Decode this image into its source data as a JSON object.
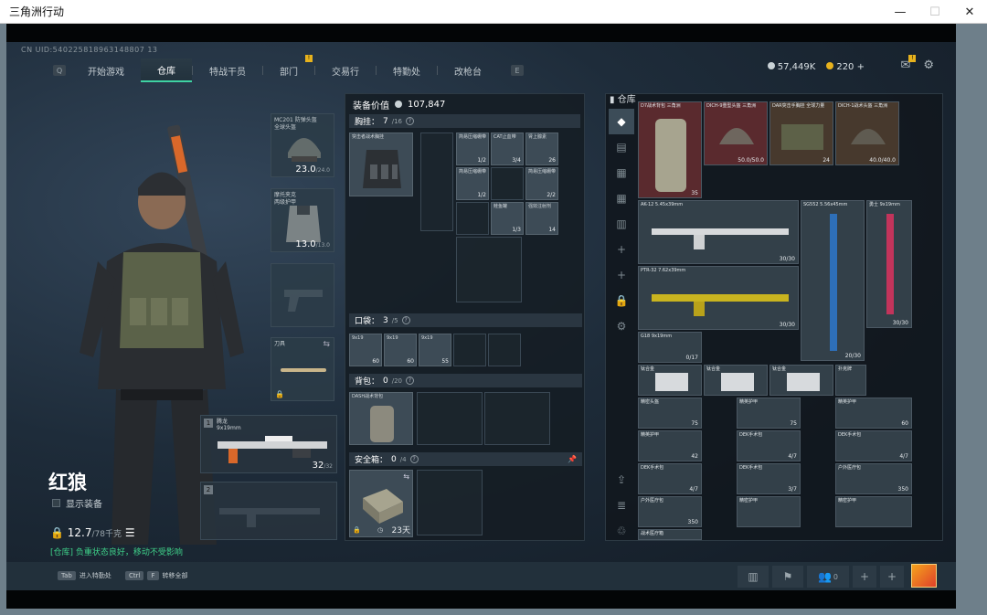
{
  "window": {
    "title": "三角洲行动",
    "minimize": "—",
    "maximize": "☐",
    "close": "✕"
  },
  "uid": "CN UID:540225818963148807 13",
  "nav": {
    "left_key": "Q",
    "right_key": "E",
    "tabs": [
      {
        "label": "开始游戏",
        "badge": ""
      },
      {
        "label": "仓库",
        "badge": ""
      },
      {
        "label": "特战干员",
        "badge": ""
      },
      {
        "label": "部门",
        "badge": "!"
      },
      {
        "label": "交易行",
        "badge": ""
      },
      {
        "label": "特勤处",
        "badge": ""
      },
      {
        "label": "改枪台",
        "badge": ""
      }
    ]
  },
  "currency": {
    "coins": "57,449K",
    "gold": "220",
    "plus": "+"
  },
  "mail_badge": "!",
  "character": {
    "name": "红狼",
    "show_equipment": "显示装备",
    "weight": "12.7",
    "weight_max": "/78千克",
    "status": "[仓库] 负重状态良好，移动不受影响"
  },
  "gear": {
    "helmet": {
      "label": "MC201 防弹头盔",
      "sub": "全球头盔",
      "value": "23.0",
      "max": "/24.0"
    },
    "armor": {
      "label": "摩托夹克",
      "sub": "两级护甲",
      "value": "13.0",
      "max": "/13.0"
    },
    "melee": {
      "label": "刀具"
    },
    "weapon1": {
      "num": "1",
      "label": "腾龙",
      "sub": "9x19mm",
      "ammo": "32",
      "ammo_max": "/32"
    },
    "weapon2": {
      "num": "2"
    }
  },
  "middle": {
    "title": "装备价值",
    "value": "107,847",
    "chest": {
      "label": "胸挂：",
      "count": "7",
      "max": "/16"
    },
    "chest_rig_name": "突击者战术胸挂",
    "chest_items": [
      {
        "label": "简易压缩绷带",
        "cnt": "1/2"
      },
      {
        "label": "CAT止血带",
        "cnt": "3/4"
      },
      {
        "label": "肾上腺素",
        "cnt": "26"
      },
      {
        "label": "简易压缩绷带",
        "cnt": "1/2"
      },
      {
        "label": "简易压缩绷带",
        "cnt": "2/2"
      },
      {
        "label": "鲑鱼罐",
        "cnt": "1/3"
      },
      {
        "label": "强效注射剂",
        "cnt": "14"
      }
    ],
    "pocket": {
      "label": "口袋：",
      "count": "3",
      "max": "/5"
    },
    "pocket_items": [
      {
        "label": "9x19",
        "cnt": "60"
      },
      {
        "label": "9x19",
        "cnt": "60"
      },
      {
        "label": "9x19",
        "cnt": "55"
      }
    ],
    "backpack": {
      "label": "背包：",
      "count": "0",
      "max": "/20"
    },
    "backpack_name": "DASH战术背包",
    "safe": {
      "label": "安全箱：",
      "count": "0",
      "max": "/4",
      "timer": "23天"
    }
  },
  "warehouse": {
    "title": "仓库",
    "items": [
      {
        "label": "D7战术背包 三角洲",
        "cnt": "35"
      },
      {
        "label": "DICH-9重型头盔 三角洲",
        "cnt": "50.0/50.0"
      },
      {
        "label": "DAR突击手胸挂 全球力量",
        "cnt": "24"
      },
      {
        "label": "DICH-1战术头盔 三角洲",
        "cnt": "40.0/40.0"
      },
      {
        "label": "AK-12 5.45x39mm",
        "cnt": "30/30"
      },
      {
        "label": "SG552 5.56x45mm",
        "cnt": ""
      },
      {
        "label": "勇士 9x19mm",
        "cnt": ""
      },
      {
        "label": "PTR-32 7.62x39mm",
        "cnt": "30/30"
      },
      {
        "label": "",
        "cnt": "20/30"
      },
      {
        "label": "",
        "cnt": "30/30"
      },
      {
        "label": "G18 9x19mm",
        "cnt": "0/17"
      },
      {
        "label": "钛合金",
        "cnt": ""
      },
      {
        "label": "钛合金",
        "cnt": ""
      },
      {
        "label": "钛合金",
        "cnt": ""
      },
      {
        "label": "扑克牌",
        "cnt": ""
      },
      {
        "label": "精密头盔",
        "cnt": "75"
      },
      {
        "label": "精英护甲",
        "cnt": "75"
      },
      {
        "label": "精英护甲",
        "cnt": "60"
      },
      {
        "label": "精英护甲",
        "cnt": "42"
      },
      {
        "label": "DEK手术包",
        "cnt": "4/7"
      },
      {
        "label": "DEK手术包",
        "cnt": "4/7"
      },
      {
        "label": "DEK手术包",
        "cnt": "4/7"
      },
      {
        "label": "DEK手术包",
        "cnt": "3/7"
      },
      {
        "label": "户外医疗包",
        "cnt": "350"
      },
      {
        "label": "户外医疗包",
        "cnt": "350"
      },
      {
        "label": "精密护甲",
        "cnt": ""
      },
      {
        "label": "精密护甲",
        "cnt": ""
      },
      {
        "label": "战术医疗箱",
        "cnt": ""
      }
    ]
  },
  "footer": {
    "hint1_key": "Tab",
    "hint1": "进入特勤处",
    "hint2_key1": "Ctrl",
    "hint2_key2": "F",
    "hint2": "转移全部",
    "friends": "0"
  },
  "colors": {
    "accent": "#3fd2a3",
    "badge": "#e7b21d",
    "red_item": "#5a2a2e"
  }
}
